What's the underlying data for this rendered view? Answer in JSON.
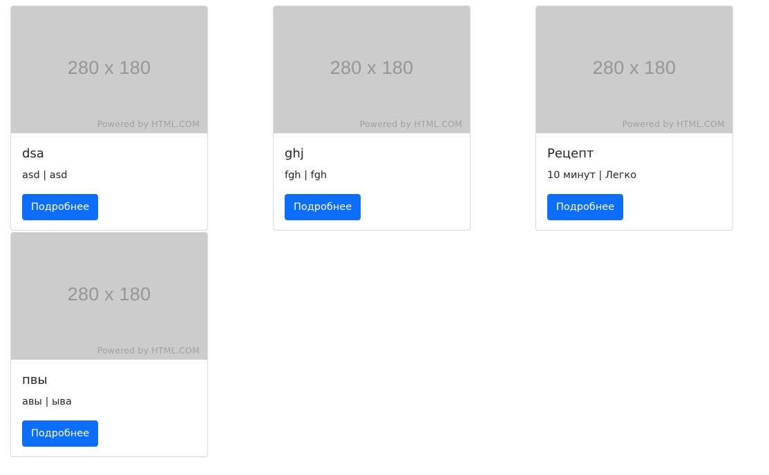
{
  "placeholder": {
    "dimensions": "280 x 180",
    "powered_by": "Powered by HTML.COM"
  },
  "cards": [
    {
      "title": "dsa",
      "meta": "asd | asd",
      "button_label": "Подробнее"
    },
    {
      "title": "ghj",
      "meta": "fgh | fgh",
      "button_label": "Подробнее"
    },
    {
      "title": "Рецепт",
      "meta": "10 минут | Легко",
      "button_label": "Подробнее"
    },
    {
      "title": "пвы",
      "meta": "авы | ыва",
      "button_label": "Подробнее"
    }
  ],
  "colors": {
    "primary_button": "#0d6efd",
    "placeholder_bg": "#cccccc",
    "border": "#dadada"
  }
}
